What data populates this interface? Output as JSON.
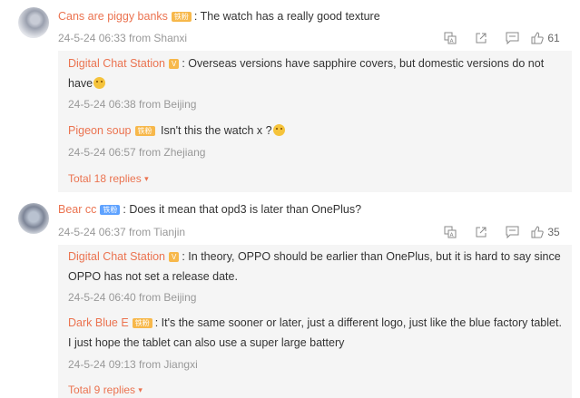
{
  "comments": [
    {
      "user": "Cans are piggy banks",
      "badge": "铁粉",
      "text": ": The watch has a really good texture",
      "meta": "24-5-24 06:33 from Shanxi",
      "likes": "61",
      "replies": [
        {
          "user": "Digital Chat Station",
          "badge": "V",
          "text": ": Overseas versions have sapphire covers, but domestic versions do not have",
          "meta": "24-5-24 06:38 from Beijing"
        },
        {
          "user": "Pigeon soup",
          "badge": "铁粉",
          "text": " Isn't this the watch x ?",
          "meta": "24-5-24 06:57 from Zhejiang"
        }
      ],
      "total_replies": "Total 18 replies"
    },
    {
      "user": "Bear cc",
      "badge": "铁粉",
      "text": ": Does it mean that opd3 is later than OnePlus?",
      "meta": "24-5-24 06:37 from Tianjin",
      "likes": "35",
      "replies": [
        {
          "user": "Digital Chat Station",
          "badge": "V",
          "text": ": In theory, OPPO should be earlier than OnePlus, but it is hard to say since OPPO has not set a release date.",
          "meta": "24-5-24 06:40 from Beijing"
        },
        {
          "user": "Dark Blue E",
          "badge": "铁粉",
          "text": ": It's the same sooner or later, just a different logo, just like the blue factory tablet. I just hope the tablet can also use a super large battery",
          "meta": "24-5-24 09:13 from Jiangxi"
        }
      ],
      "total_replies": "Total 9 replies"
    }
  ],
  "icons": {
    "translate": "translate-icon",
    "share": "share-icon",
    "comment": "comment-icon",
    "like": "thumbs-up-icon"
  },
  "colors": {
    "username": "#eb7350",
    "meta": "#999999",
    "reply_bg": "#f5f5f5",
    "fan_badge": "#f7b84b",
    "blue_badge": "#5ea2ff"
  }
}
